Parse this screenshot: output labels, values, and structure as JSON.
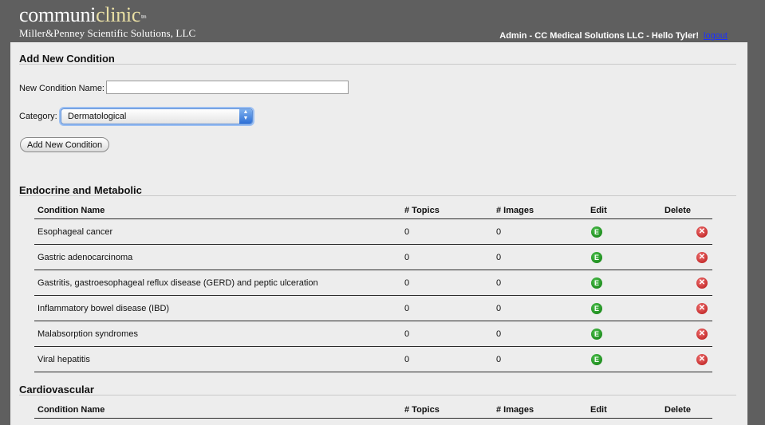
{
  "brand": {
    "logo_part1": "communi",
    "logo_part2": "clinic",
    "trademark": "tm",
    "company": "Miller&Penney Scientific Solutions, LLC"
  },
  "user": {
    "greeting": "Admin - CC Medical Solutions LLC - Hello Tyler!",
    "logout": "logout"
  },
  "form": {
    "title": "Add New Condition",
    "name_label": "New Condition Name:",
    "name_value": "",
    "category_label": "Category:",
    "category_value": "Dermatological",
    "submit": "Add New Condition"
  },
  "columns": [
    "Condition Name",
    "# Topics",
    "# Images",
    "Edit",
    "Delete"
  ],
  "groups": [
    {
      "title": "Endocrine and Metabolic",
      "rows": [
        {
          "name": "Esophageal cancer",
          "topics": "0",
          "images": "0"
        },
        {
          "name": "Gastric adenocarcinoma",
          "topics": "0",
          "images": "0"
        },
        {
          "name": "Gastritis, gastroesophageal reflux disease (GERD) and peptic ulceration",
          "topics": "0",
          "images": "0"
        },
        {
          "name": "Inflammatory bowel disease (IBD)",
          "topics": "0",
          "images": "0"
        },
        {
          "name": "Malabsorption syndromes",
          "topics": "0",
          "images": "0"
        },
        {
          "name": "Viral hepatitis",
          "topics": "0",
          "images": "0"
        }
      ]
    },
    {
      "title": "Cardiovascular",
      "rows": []
    }
  ],
  "icons": {
    "edit": {
      "name": "edit-icon",
      "glyph": "E",
      "color": "#1e9a1e"
    },
    "delete": {
      "name": "delete-icon",
      "glyph": "✕",
      "color": "#d42a2a"
    }
  },
  "colors": {
    "background": "#5f5f5f",
    "panel": "#ededed",
    "logo_accent": "#e9dfa4",
    "link": "#1a30ff"
  }
}
